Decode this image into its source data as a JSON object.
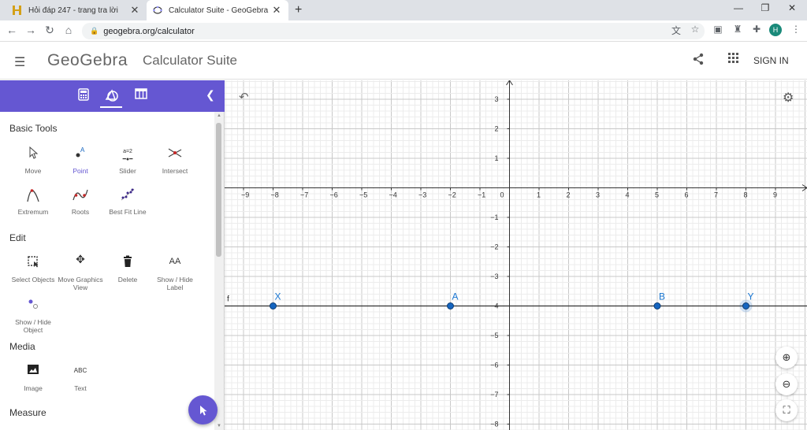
{
  "browser": {
    "tabs": [
      {
        "title": "Hỏi đáp 247 - trang tra lời",
        "active": false,
        "icon": "h247-favicon"
      },
      {
        "title": "Calculator Suite - GeoGebra",
        "active": true,
        "icon": "geogebra-favicon"
      }
    ],
    "new_tab": "+",
    "url": "geogebra.org/calculator",
    "profile_initial": "H"
  },
  "header": {
    "logo": "GeoGebra",
    "app_name": "Calculator Suite",
    "sign_in": "SIGN IN"
  },
  "sidebar": {
    "sections": [
      {
        "title": "Basic Tools",
        "tools": [
          {
            "label": "Move",
            "icon": "arrow-icon"
          },
          {
            "label": "Point",
            "icon": "point-icon",
            "selected": true
          },
          {
            "label": "Slider",
            "icon": "slider-icon",
            "glyph_text": "a=2"
          },
          {
            "label": "Intersect",
            "icon": "intersect-icon"
          },
          {
            "label": "Extremum",
            "icon": "extremum-icon"
          },
          {
            "label": "Roots",
            "icon": "roots-icon"
          },
          {
            "label": "Best Fit Line",
            "icon": "best-fit-line-icon"
          }
        ]
      },
      {
        "title": "Edit",
        "tools": [
          {
            "label": "Select Objects",
            "icon": "select-objects-icon"
          },
          {
            "label": "Move Graphics View",
            "icon": "move-graphics-icon"
          },
          {
            "label": "Delete",
            "icon": "delete-icon"
          },
          {
            "label": "Show / Hide Label",
            "icon": "label-icon",
            "glyph_text": "AA"
          },
          {
            "label": "Show / Hide Object",
            "icon": "show-hide-object-icon"
          }
        ]
      },
      {
        "title": "Media",
        "tools": [
          {
            "label": "Image",
            "icon": "image-icon"
          },
          {
            "label": "Text",
            "icon": "text-icon",
            "glyph_text": "ABC"
          }
        ]
      },
      {
        "title": "Measure",
        "tools": []
      }
    ]
  },
  "graph": {
    "x_ticks": [
      "-9",
      "-8",
      "-7",
      "-6",
      "-5",
      "-4",
      "-3",
      "-2",
      "-1",
      "0",
      "1",
      "2",
      "3",
      "4",
      "5",
      "6",
      "7",
      "8",
      "9"
    ],
    "y_ticks": [
      "3",
      "2",
      "1",
      "-1",
      "-2",
      "-3",
      "-4",
      "-5",
      "-6",
      "-7",
      "-8"
    ],
    "line_label": "f",
    "line_y": -4,
    "points": [
      {
        "name": "X",
        "x": -8,
        "y": -4
      },
      {
        "name": "A",
        "x": -2,
        "y": -4
      },
      {
        "name": "B",
        "x": 5,
        "y": -4
      },
      {
        "name": "Y",
        "x": 8,
        "y": -4,
        "highlighted": true
      }
    ]
  },
  "colors": {
    "accent": "#6557d2",
    "point": "#1565c0",
    "point_label": "#1976d2"
  }
}
